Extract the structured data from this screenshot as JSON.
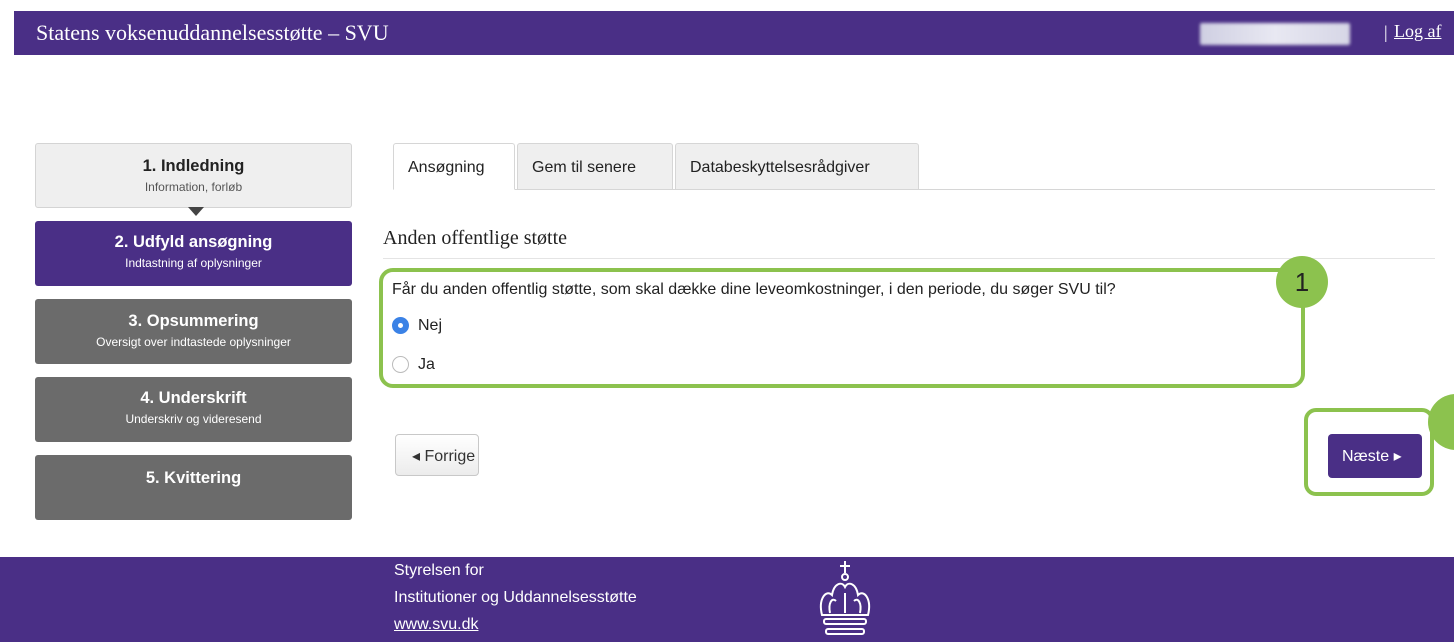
{
  "header": {
    "title": "Statens voksenuddannelsesstøtte – SVU",
    "separator": "|",
    "logout": "Log af"
  },
  "steps": [
    {
      "title": "1. Indledning",
      "subtitle": "Information, forløb",
      "state": "done"
    },
    {
      "title": "2. Udfyld ansøgning",
      "subtitle": "Indtastning af oplysninger",
      "state": "active"
    },
    {
      "title": "3. Opsummering",
      "subtitle": "Oversigt over indtastede oplysninger",
      "state": "pending"
    },
    {
      "title": "4. Underskrift",
      "subtitle": "Underskriv og videresend",
      "state": "pending"
    },
    {
      "title": "5. Kvittering",
      "subtitle": "",
      "state": "pending"
    }
  ],
  "tabs": [
    {
      "label": "Ansøgning",
      "active": true
    },
    {
      "label": "Gem til senere",
      "active": false
    },
    {
      "label": "Databeskyttelsesrådgiver",
      "active": false
    }
  ],
  "form": {
    "section_title": "Anden offentlige støtte",
    "question": "Får du anden offentlig støtte, som skal dække dine leveomkostninger, i den periode, du søger SVU til?",
    "help_icon": "?",
    "required_mark": "*",
    "options": [
      {
        "label": "Nej",
        "checked": true
      },
      {
        "label": "Ja",
        "checked": false
      }
    ]
  },
  "annotations": {
    "badge_1": "1"
  },
  "nav": {
    "prev_label": "◂ Forrige",
    "next_label": "Næste ▸"
  },
  "footer": {
    "org_line1": "Styrelsen for",
    "org_line2": "Institutioner og Uddannelsesstøtte",
    "link": "www.svu.dk"
  },
  "colors": {
    "brand": "#4a2f86",
    "highlight": "#8cc24e",
    "step_pending": "#6b6b6b",
    "radio_checked": "#3b82e6"
  }
}
